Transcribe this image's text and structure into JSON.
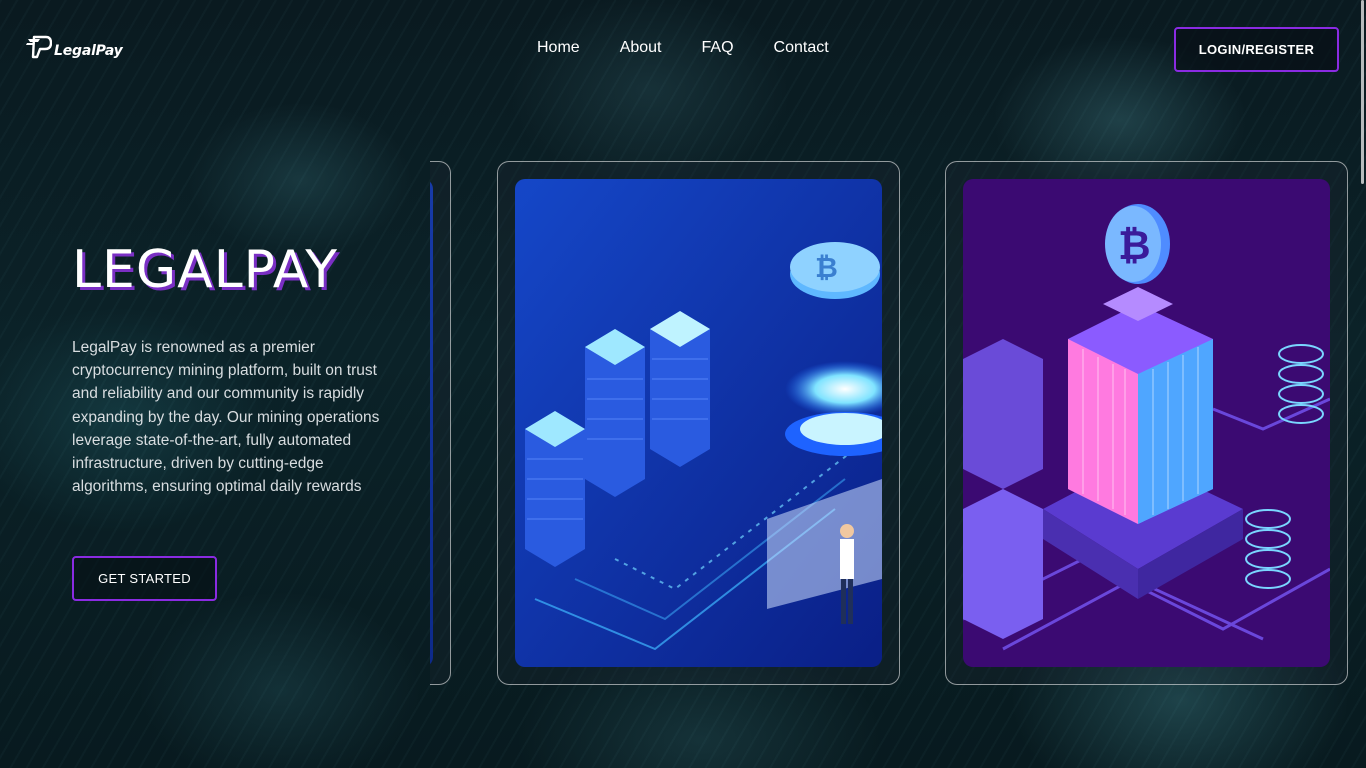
{
  "app": {
    "name": "LegalPay"
  },
  "header": {
    "logo_text": "LegalPay",
    "nav": [
      {
        "label": "Home"
      },
      {
        "label": "About"
      },
      {
        "label": "FAQ"
      },
      {
        "label": "Contact"
      }
    ],
    "login_label": "LOGIN/REGISTER"
  },
  "hero": {
    "title": "LEGALPAY",
    "description": "LegalPay is renowned as a premier cryptocurrency mining platform, built on trust and reliability and our community is rapidly expanding by the day. Our mining operations leverage state-of-the-art, fully automated infrastructure, driven by cutting-edge algorithms, ensuring optimal daily rewards",
    "cta_label": "GET STARTED"
  },
  "carousel": {
    "cards": [
      {
        "illustration": "server-mining-illustration"
      },
      {
        "illustration": "bitcoin-tower-illustration"
      }
    ]
  },
  "colors": {
    "accent": "#8a2be2",
    "title_shadow": "#7a2fc4",
    "background": "#0b2228"
  }
}
